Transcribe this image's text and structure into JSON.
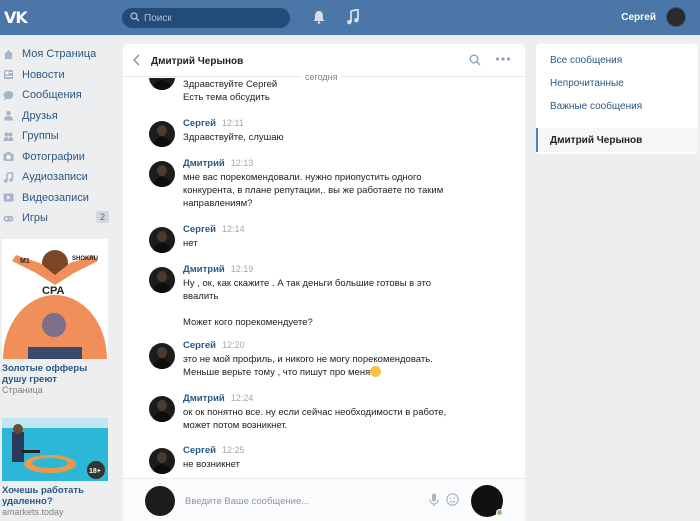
{
  "header": {
    "logo": "VK",
    "search_placeholder": "Поиск",
    "user_name": "Сергей"
  },
  "sidebar": {
    "items": [
      {
        "label": "Моя Страница",
        "icon": "home-icon"
      },
      {
        "label": "Новости",
        "icon": "news-icon"
      },
      {
        "label": "Сообщения",
        "icon": "messages-icon"
      },
      {
        "label": "Друзья",
        "icon": "friends-icon"
      },
      {
        "label": "Группы",
        "icon": "groups-icon"
      },
      {
        "label": "Фотографии",
        "icon": "camera-icon"
      },
      {
        "label": "Аудиозаписи",
        "icon": "audio-icon"
      },
      {
        "label": "Видеозаписи",
        "icon": "video-icon"
      },
      {
        "label": "Игры",
        "icon": "games-icon",
        "badge": "2"
      }
    ]
  },
  "ads": [
    {
      "image_text": [
        "М1",
        "SHOKRU",
        "CPA"
      ],
      "title": "Золотые офферы душу греют",
      "subtitle": "Страница"
    },
    {
      "badge": "18+",
      "title": "Хочешь работать удаленно?",
      "subtitle": "amarkets.today"
    }
  ],
  "chat": {
    "title": "Дмитрий Черынов",
    "date_separator": "сегодня",
    "messages": [
      {
        "author": "",
        "time": "",
        "lines": [
          "Здравствуйте Сергей",
          "Есть тема обсудить"
        ]
      },
      {
        "author": "Сергей",
        "time": "12:11",
        "lines": [
          "Здравствуйте, слушаю"
        ]
      },
      {
        "author": "Дмитрий",
        "time": "12:13",
        "lines": [
          "мне вас порекомендовали. нужно приопустить одного",
          "конкурента, в плане репутации,. вы же работаете по таким",
          "направлениям?"
        ]
      },
      {
        "author": "Сергей",
        "time": "12:14",
        "lines": [
          "нет"
        ]
      },
      {
        "author": "Дмитрий",
        "time": "12:19",
        "lines": [
          "Ну , ок, как скажите . А так деньги большие готовы в это",
          "ввалить",
          "",
          "Может кого порекомендуете?"
        ]
      },
      {
        "author": "Сергей",
        "time": "12:20",
        "lines": [
          "это не мой профиль, и никого не могу порекомендовать.",
          "Меньше верьте тому , что пишут про меня"
        ]
      },
      {
        "author": "Дмитрий",
        "time": "12:24",
        "lines": [
          "ок ок понятно все. ну если сейчас необходимости в работе,",
          "может потом возникнет."
        ]
      },
      {
        "author": "Сергей",
        "time": "12:25",
        "lines": [
          "не возникнет"
        ]
      }
    ],
    "composer_placeholder": "Введите Ваше сообщение..."
  },
  "filters": {
    "items": [
      "Все сообщения",
      "Непрочитанные",
      "Важные сообщения"
    ],
    "active": "Дмитрий Черынов"
  },
  "colors": {
    "header_bg": "#4a76a8",
    "link": "#2a5885",
    "page_bg": "#edeef0"
  }
}
